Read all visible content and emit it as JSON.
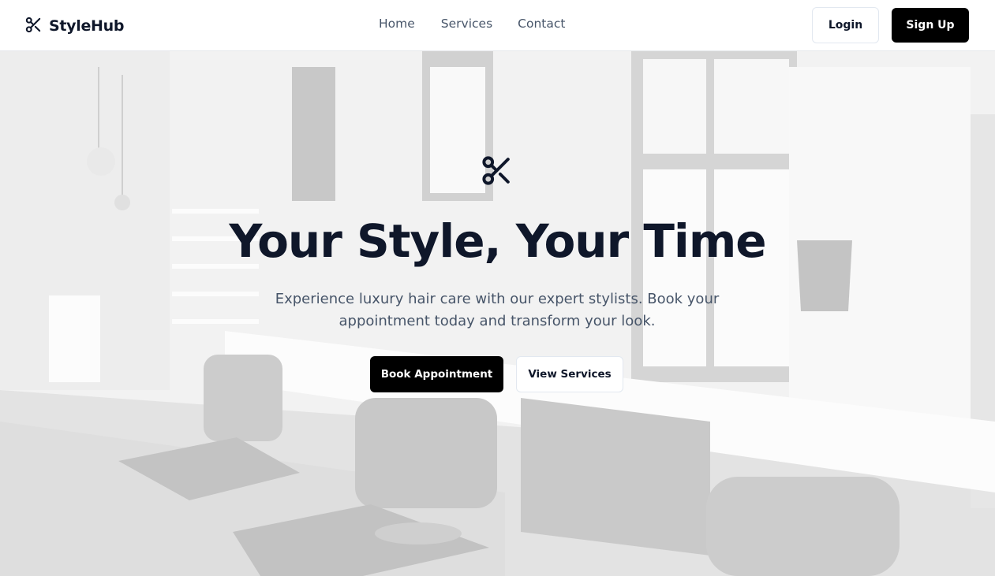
{
  "brand": {
    "name": "StyleHub",
    "icon": "scissors-icon"
  },
  "nav": {
    "links": [
      {
        "label": "Home"
      },
      {
        "label": "Services"
      },
      {
        "label": "Contact"
      }
    ],
    "login_label": "Login",
    "signup_label": "Sign Up"
  },
  "hero": {
    "icon": "scissors-icon",
    "title": "Your Style, Your Time",
    "subtitle": "Experience luxury hair care with our expert stylists. Book your appointment today and transform your look.",
    "primary_button": "Book Appointment",
    "secondary_button": "View Services",
    "background": "black-and-white salon interior photo"
  },
  "colors": {
    "primary": "#000000",
    "heading": "#0f172a",
    "muted_text": "#475569",
    "border": "#e2e8f0"
  }
}
